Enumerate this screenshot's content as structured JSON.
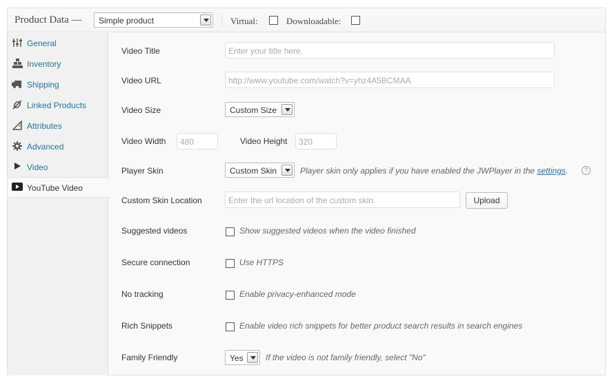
{
  "header": {
    "title": "Product Data —",
    "product_type": "Simple product",
    "virtual_label": "Virtual:",
    "downloadable_label": "Downloadable:"
  },
  "sidebar": {
    "items": [
      {
        "label": "General",
        "icon": "sliders-icon"
      },
      {
        "label": "Inventory",
        "icon": "boxes-icon"
      },
      {
        "label": "Shipping",
        "icon": "truck-icon"
      },
      {
        "label": "Linked Products",
        "icon": "link-icon"
      },
      {
        "label": "Attributes",
        "icon": "ruler-icon"
      },
      {
        "label": "Advanced",
        "icon": "gear-icon"
      },
      {
        "label": "Video",
        "icon": "play-icon"
      },
      {
        "label": "YouTube Video",
        "icon": "youtube-icon",
        "active": true
      }
    ]
  },
  "form": {
    "video_title": {
      "label": "Video Title",
      "placeholder": "Enter your title here."
    },
    "video_url": {
      "label": "Video URL",
      "placeholder": "http://www.youtube.com/watch?v=yhz4A5BCMAA"
    },
    "video_size": {
      "label": "Video Size",
      "value": "Custom Size"
    },
    "video_width": {
      "label": "Video Width",
      "placeholder": "480"
    },
    "video_height": {
      "label": "Video Height",
      "placeholder": "320"
    },
    "player_skin": {
      "label": "Player Skin",
      "value": "Custom Skin",
      "desc": "Player skin only applies if you have enabled the JWPlayer in the ",
      "link": "settings",
      "desc_end": "."
    },
    "custom_skin_location": {
      "label": "Custom Skin Location",
      "placeholder": "Enter the url location of the custom skin.",
      "button": "Upload"
    },
    "suggested_videos": {
      "label": "Suggested videos",
      "desc": "Show suggested videos when the video finished"
    },
    "secure_connection": {
      "label": "Secure connection",
      "desc": "Use HTTPS"
    },
    "no_tracking": {
      "label": "No tracking",
      "desc": "Enable privacy-enhanced mode"
    },
    "rich_snippets": {
      "label": "Rich Snippets",
      "desc": "Enable video rich snippets for better product search results in search engines"
    },
    "family_friendly": {
      "label": "Family Friendly",
      "value": "Yes",
      "desc": "If the video is not family friendly, select \"No\""
    }
  },
  "help_icon": "?"
}
